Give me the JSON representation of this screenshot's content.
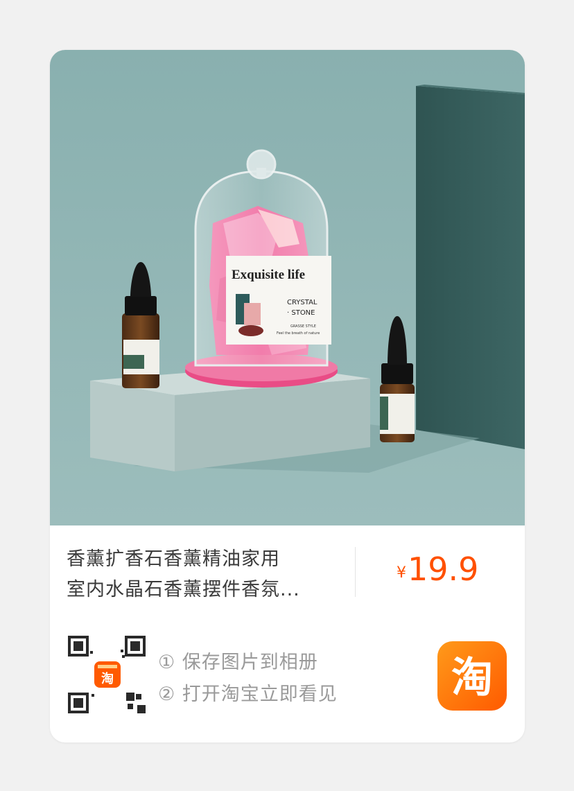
{
  "product": {
    "image_label": {
      "brand": "Exquisite life",
      "line1": "CRYSTAL",
      "line2": "· STONE",
      "sub1": "GRASSE STYLE",
      "sub2": "Feel the breath of nature"
    },
    "title_line1": "香薰扩香石香薰精油家用",
    "title_line2": "室内水晶石香薰摆件香氛...",
    "currency": "¥",
    "price": "19.9"
  },
  "share": {
    "step1": "① 保存图片到相册",
    "step2": "② 打开淘宝立即看见",
    "qr_badge_text": "淘",
    "app_icon_text": "淘"
  },
  "colors": {
    "price": "#ff5000",
    "background": "#8fb4b3",
    "app_icon": "#ff6a00"
  }
}
